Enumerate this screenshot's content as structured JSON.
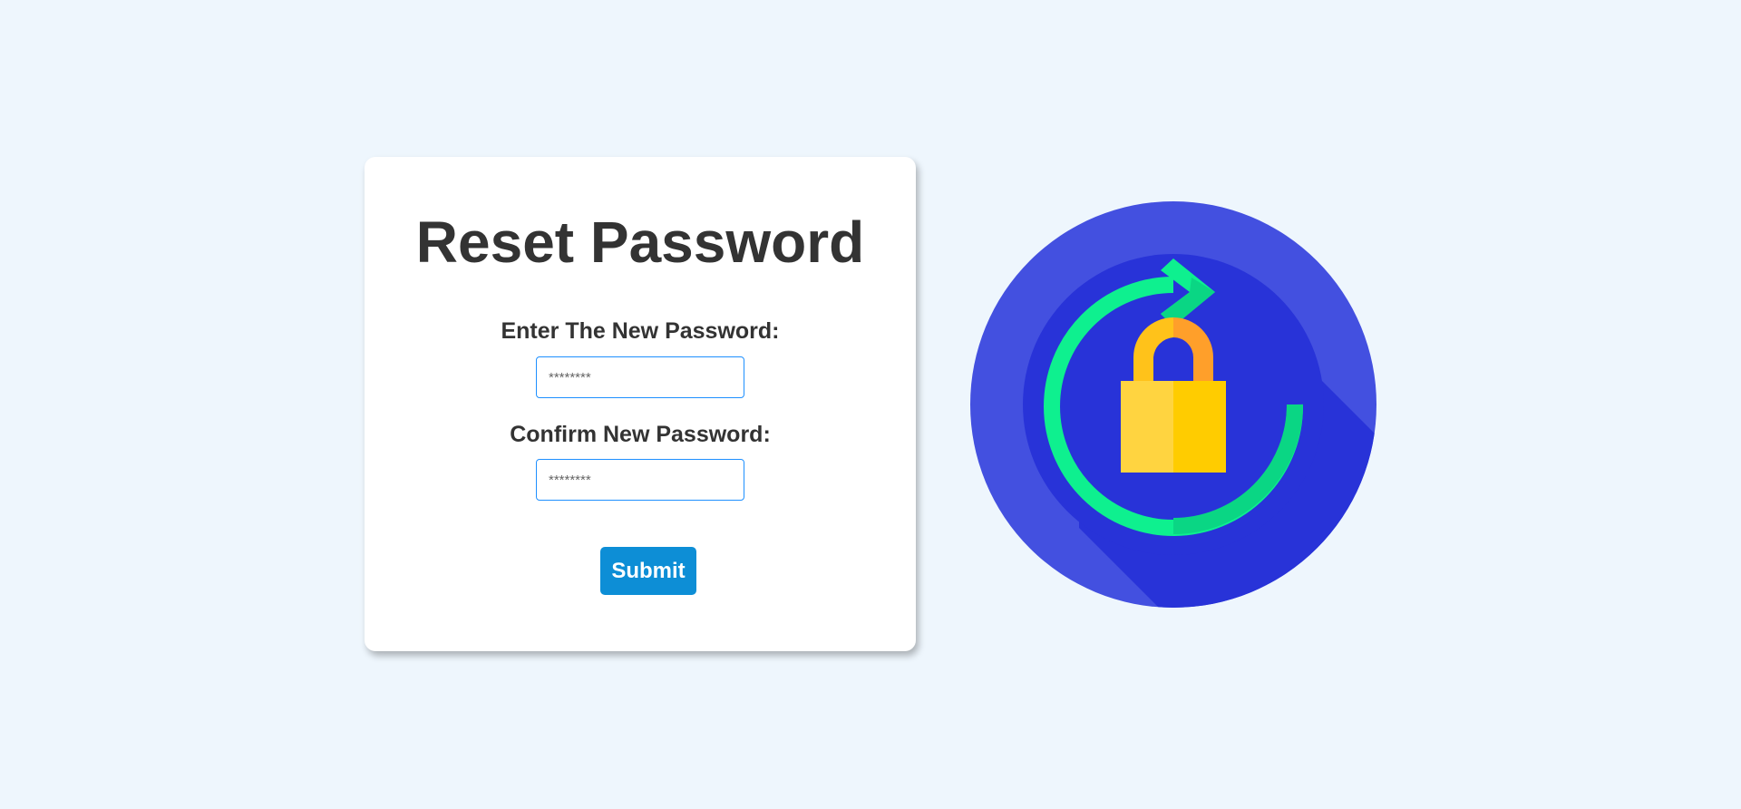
{
  "reset_form": {
    "title": "Reset Password",
    "new_password_label": "Enter The New Password:",
    "new_password_placeholder": "********",
    "new_password_value": "",
    "confirm_password_label": "Confirm New Password:",
    "confirm_password_placeholder": "********",
    "confirm_password_value": "",
    "submit_label": "Submit"
  },
  "illustration": {
    "icon": "lock-reset-icon",
    "colors": {
      "circle": "#4350e0",
      "shadow": "#2833d8",
      "arrow": "#0ef08f",
      "lock_light": "#ffd440",
      "lock_dark": "#ffcc00",
      "shackle_light": "#ffc21a",
      "shackle_dark": "#ff9f2a"
    }
  },
  "theme": {
    "background": "#eef6fd",
    "accent": "#0d8ed6",
    "text": "#333333",
    "input_border": "#1e90ff"
  }
}
